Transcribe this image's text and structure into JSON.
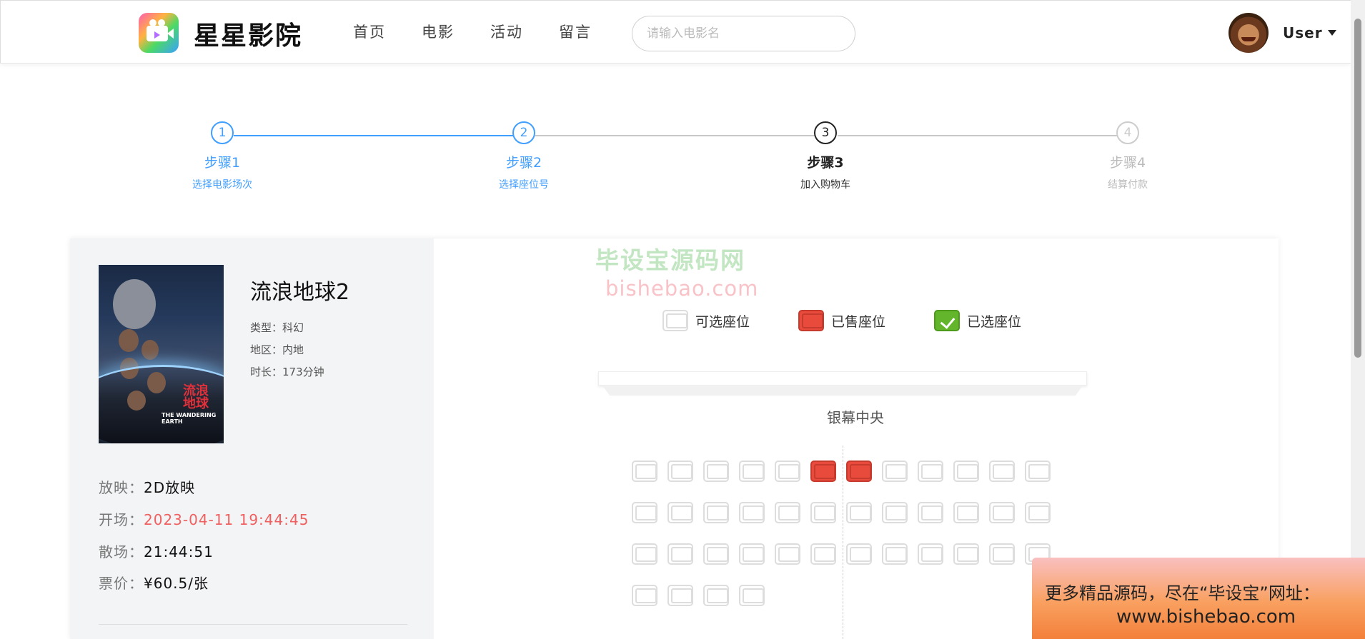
{
  "header": {
    "site_name": "星星影院",
    "nav": [
      "首页",
      "电影",
      "活动",
      "留言"
    ],
    "search_placeholder": "请输入电影名",
    "user_label": "User"
  },
  "steps": [
    {
      "num": "1",
      "title": "步骤1",
      "desc": "选择电影场次",
      "state": "done"
    },
    {
      "num": "2",
      "title": "步骤2",
      "desc": "选择座位号",
      "state": "done"
    },
    {
      "num": "3",
      "title": "步骤3",
      "desc": "加入购物车",
      "state": "active"
    },
    {
      "num": "4",
      "title": "步骤4",
      "desc": "结算付款",
      "state": "wait"
    }
  ],
  "movie": {
    "title": "流浪地球2",
    "genre": "类型：科幻",
    "region": "地区：内地",
    "duration": "时长：173分钟",
    "poster_red_text": "流浪地球",
    "poster_en_text": "THE WANDERING EARTH"
  },
  "session": {
    "format_key": "放映：",
    "format_val": "2D放映",
    "start_key": "开场：",
    "start_val": "2023-04-11 19:44:45",
    "end_key": "散场：",
    "end_val": "21:44:51",
    "price_key": "票价：",
    "price_val": "¥60.5/张"
  },
  "legend": {
    "available": "可选座位",
    "sold": "已售座位",
    "selected": "已选座位"
  },
  "screen_label": "银幕中央",
  "seats": {
    "rows": [
      [
        "a",
        "a",
        "a",
        "a",
        "a",
        "s",
        "s",
        "a",
        "a",
        "a",
        "a",
        "a"
      ],
      [
        "a",
        "a",
        "a",
        "a",
        "a",
        "a",
        "a",
        "a",
        "a",
        "a",
        "a",
        "a"
      ],
      [
        "a",
        "a",
        "a",
        "a",
        "a",
        "a",
        "a",
        "a",
        "a",
        "a",
        "a",
        "a"
      ],
      [
        "a",
        "a",
        "a",
        "a"
      ]
    ]
  },
  "watermark": {
    "line1": "毕设宝源码网",
    "line2": "bishebao.com"
  },
  "ad": {
    "line1": "更多精品源码，尽在“毕设宝”网址：",
    "line2": "www.bishebao.com"
  },
  "colors": {
    "accent": "#409eff",
    "sold": "#e84a3c",
    "selected": "#63b52c",
    "start_time": "#f06060"
  }
}
